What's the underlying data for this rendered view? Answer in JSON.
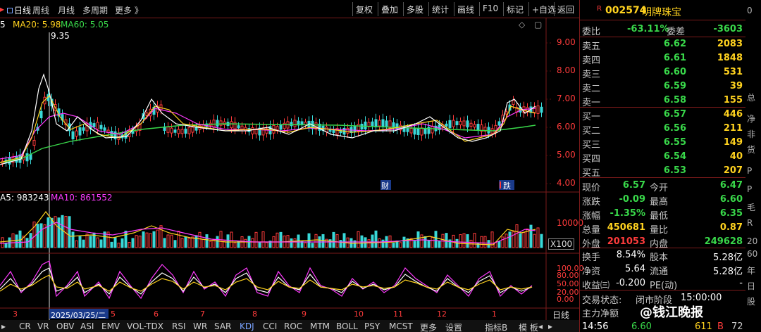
{
  "tabs": {
    "daily": "日线",
    "weekly": "周线",
    "monthly": "月线",
    "multi": "多周期",
    "more": "更多 》"
  },
  "toolbar": [
    "复权",
    "叠加",
    "多股",
    "统计",
    "画线",
    "F10",
    "标记",
    "+自选",
    "返回"
  ],
  "ma_main": {
    "ma5_partial": "5",
    "ma20": "MA20: 5.98",
    "ma60": "MA60: 5.05",
    "ma5_color": "#ffffff",
    "ma20_color": "#ffd21f",
    "ma60_color": "#39d84a"
  },
  "high_mark": "9.35",
  "price_ticks": [
    "9.00",
    "8.00",
    "7.00",
    "6.00",
    "5.00",
    "4.00"
  ],
  "event_tags": {
    "finance": "财",
    "drop": "跌"
  },
  "vol_legend": {
    "ma5": "A5: 983243",
    "ma10": "MA10: 861552"
  },
  "vol_ticks": {
    "top": "10000",
    "unit": "X100"
  },
  "ind_ticks": [
    "100.00",
    "80.00",
    "50.00",
    "20.00",
    "0.00"
  ],
  "dates": [
    "3",
    "2025/03/25/二",
    "5",
    "6",
    "7",
    "8",
    "9",
    "10",
    "11",
    "12",
    "1"
  ],
  "period_label": "日线",
  "indicators": [
    "CR",
    "VR",
    "OBV",
    "ASI",
    "EMV",
    "VOL-TDX",
    "RSI",
    "WR",
    "SAR",
    "KDJ",
    "CCI",
    "ROC",
    "MTM",
    "BOLL",
    "PSY",
    "MCST",
    "更多",
    "设置",
    "指标B",
    "模 板"
  ],
  "active_indicator": "KDJ",
  "stock": {
    "badge": "R",
    "code": "002574",
    "name": "明牌珠宝"
  },
  "weibi": {
    "label1": "委比",
    "val1": "-63.11%",
    "label2": "委差",
    "val2": "-3603"
  },
  "sells": [
    {
      "label": "卖五",
      "price": "6.62",
      "vol": "2083"
    },
    {
      "label": "卖四",
      "price": "6.61",
      "vol": "1848"
    },
    {
      "label": "卖三",
      "price": "6.60",
      "vol": "531"
    },
    {
      "label": "卖二",
      "price": "6.59",
      "vol": "39"
    },
    {
      "label": "卖一",
      "price": "6.58",
      "vol": "155"
    }
  ],
  "buys": [
    {
      "label": "买一",
      "price": "6.57",
      "vol": "446"
    },
    {
      "label": "买二",
      "price": "6.56",
      "vol": "211"
    },
    {
      "label": "买三",
      "price": "6.55",
      "vol": "149"
    },
    {
      "label": "买四",
      "price": "6.54",
      "vol": "40"
    },
    {
      "label": "买五",
      "price": "6.53",
      "vol": "207"
    }
  ],
  "stats": [
    {
      "k1": "现价",
      "v1": "6.57",
      "c1": "#39d84a",
      "k2": "今开",
      "v2": "6.47",
      "c2": "#39d84a"
    },
    {
      "k1": "涨跌",
      "v1": "-0.09",
      "c1": "#39d84a",
      "k2": "最高",
      "v2": "6.60",
      "c2": "#39d84a"
    },
    {
      "k1": "涨幅",
      "v1": "-1.35%",
      "c1": "#39d84a",
      "k2": "最低",
      "v2": "6.35",
      "c2": "#39d84a"
    },
    {
      "k1": "总量",
      "v1": "450681",
      "c1": "#ffd21f",
      "k2": "量比",
      "v2": "0.87",
      "c2": "#ffd21f"
    },
    {
      "k1": "外盘",
      "v1": "201053",
      "c1": "#ff3b3b",
      "k2": "内盘",
      "v2": "249628",
      "c2": "#39d84a"
    }
  ],
  "stats2": [
    {
      "k1": "换手",
      "v1": "8.54%",
      "k2": "股本",
      "v2": "5.28亿"
    },
    {
      "k1": "净资",
      "v1": "5.64",
      "k2": "流通",
      "v2": "5.28亿"
    },
    {
      "k1": "收益㈢",
      "v1": "-0.200",
      "k2": "PE(动)",
      "v2": "-"
    }
  ],
  "trade_state": {
    "label": "交易状态:",
    "phase": "闭市阶段",
    "time": "15:00:00"
  },
  "main_net": "主力净额",
  "watermark": "@钱江晚报",
  "tick_row": {
    "time": "14:56",
    "price": "6.60",
    "vol": "611",
    "side": "B",
    "n": "72"
  },
  "edge_chars": [
    "0",
    "总",
    "净",
    "非",
    "货",
    "P",
    "P",
    "毛",
    "R",
    "20",
    "60",
    "年",
    "日",
    "股"
  ]
}
